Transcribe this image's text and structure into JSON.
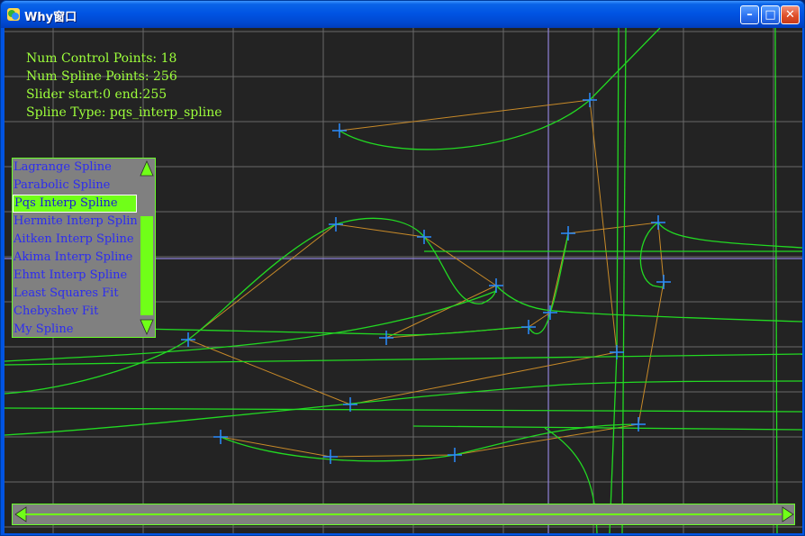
{
  "window": {
    "title": "Why窗口",
    "buttons": {
      "minimize_glyph": "–",
      "maximize_glyph": "□",
      "close_glyph": "✕"
    }
  },
  "hud": {
    "control_points": "Num Control Points: 18",
    "spline_points": "Num Spline Points: 256",
    "slider": "Slider start:0 end:255",
    "spline_type": "Spline Type: pqs_interp_spline"
  },
  "spline_list": {
    "items": [
      "Lagrange Spline",
      "Parabolic Spline",
      "Pqs Interp Spline",
      "Hermite Interp Spline",
      "Aitken Interp Spline",
      "Akima Interp Spline",
      "Ehmt Interp Spline",
      "Least Squares Fit",
      "Chebyshev Fit",
      "My Spline"
    ],
    "selected_index": 2
  },
  "colors": {
    "background": "#232323",
    "grid": "#6a6a6a",
    "axis": "#8f82d8",
    "curve": "#22d922",
    "control_polygon": "#c88a28",
    "control_marker": "#2a8cff",
    "accent": "#70ff18",
    "list_text": "#2c2cf0"
  }
}
